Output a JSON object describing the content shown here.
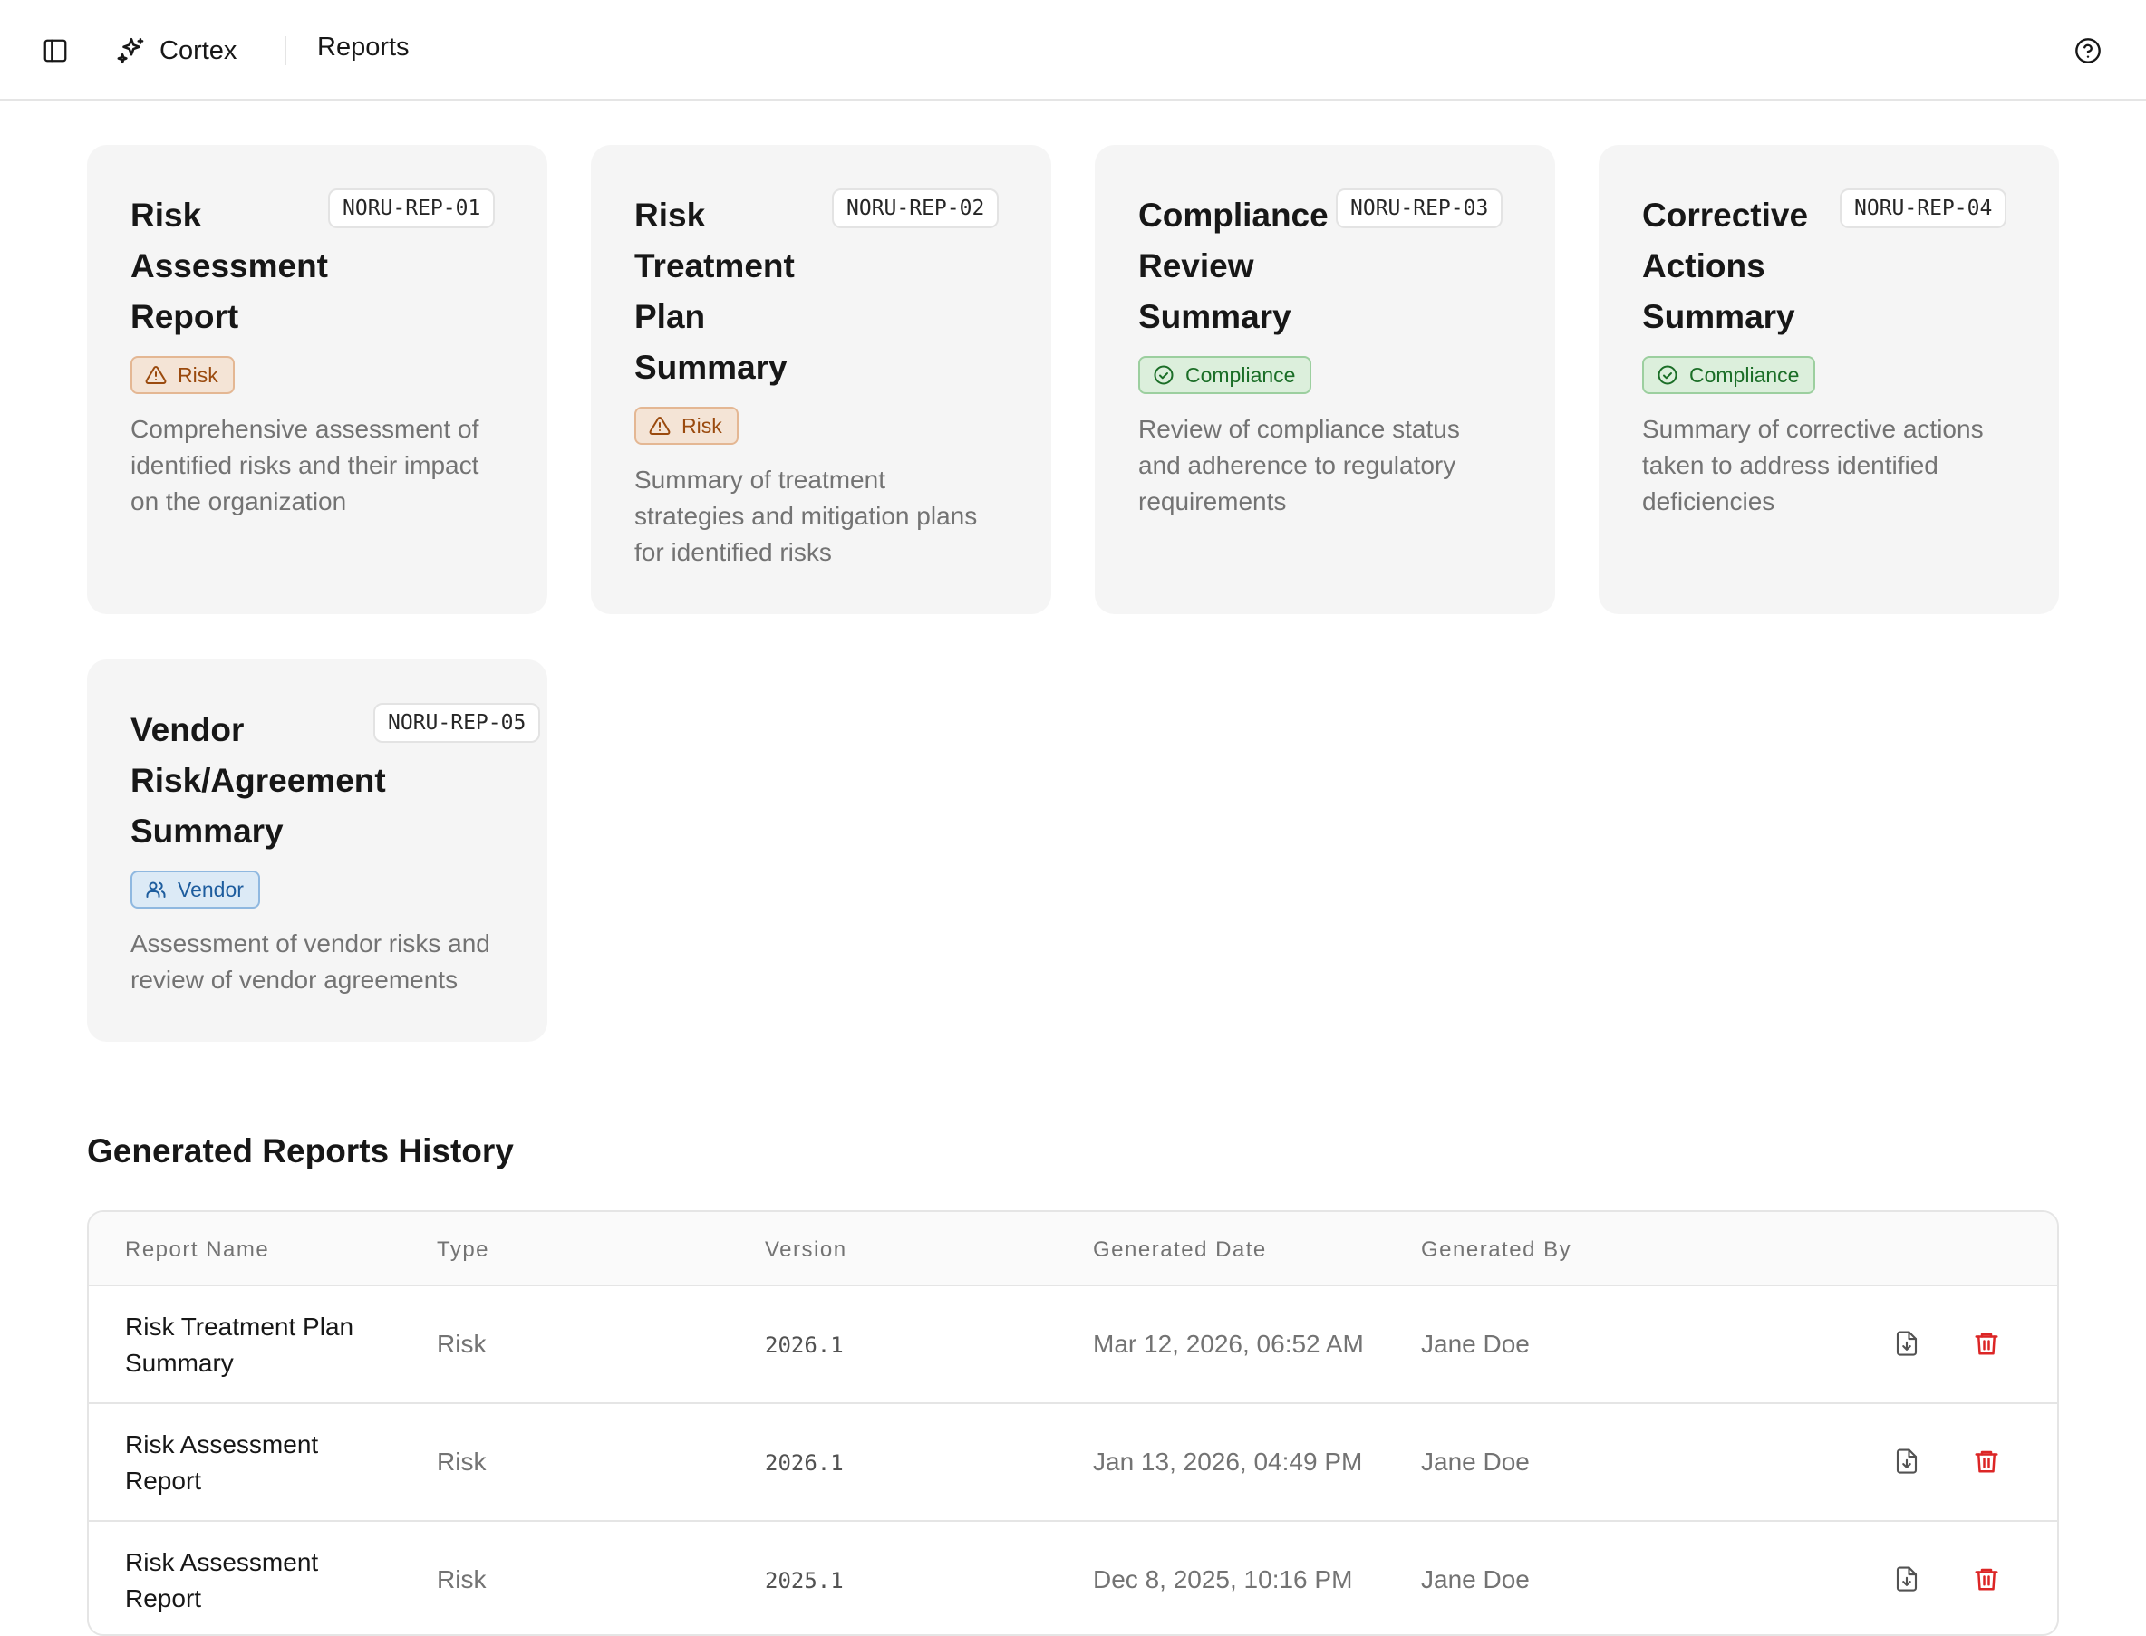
{
  "header": {
    "app_name": "Cortex",
    "breadcrumb": "Reports",
    "icons": {
      "sidebar": "sidebar-toggle-icon",
      "brand": "sparkles-icon",
      "help": "help-circle-icon"
    }
  },
  "cards": [
    {
      "title_lines": [
        "Risk",
        "Assessment",
        "Report"
      ],
      "code": "NORU-REP-01",
      "tag": "Risk",
      "tag_icon": "alert-triangle-icon",
      "desc_lines": [
        "Comprehensive assessment of",
        "identified risks and their impact",
        "on the organization"
      ]
    },
    {
      "title_lines": [
        "Risk",
        "Treatment",
        "Plan",
        "Summary"
      ],
      "code": "NORU-REP-02",
      "tag": "Risk",
      "tag_icon": "alert-triangle-icon",
      "desc_lines": [
        "Summary of treatment",
        "strategies and mitigation plans",
        "for identified risks"
      ]
    },
    {
      "title_lines": [
        "Compliance",
        "Review",
        "Summary"
      ],
      "code": "NORU-REP-03",
      "tag": "Compliance",
      "tag_icon": "check-circle-icon",
      "desc_lines": [
        "Review of compliance status",
        "and adherence to regulatory",
        "requirements"
      ]
    },
    {
      "title_lines": [
        "Corrective",
        "Actions",
        "Summary"
      ],
      "code": "NORU-REP-04",
      "tag": "Compliance",
      "tag_icon": "check-circle-icon",
      "desc_lines": [
        "Summary of corrective actions",
        "taken to address identified",
        "deficiencies"
      ]
    },
    {
      "title_lines": [
        "Vendor",
        "Risk/Agreement",
        "Summary"
      ],
      "code": "NORU-REP-05",
      "tag": "Vendor",
      "tag_icon": "users-icon",
      "desc_lines": [
        "Assessment of vendor risks and",
        "review of vendor agreements"
      ]
    }
  ],
  "history": {
    "title": "Generated Reports History",
    "columns": [
      "Report Name",
      "Type",
      "Version",
      "Generated Date",
      "Generated By"
    ],
    "rows": [
      {
        "name_lines": [
          "Risk Treatment Plan",
          "Summary"
        ],
        "type": "Risk",
        "version": "2026.1",
        "date": "Mar 12, 2026, 06:52 AM",
        "by": "Jane Doe"
      },
      {
        "name_lines": [
          "Risk Assessment",
          "Report"
        ],
        "type": "Risk",
        "version": "2026.1",
        "date": "Jan 13, 2026, 04:49 PM",
        "by": "Jane Doe"
      },
      {
        "name_lines": [
          "Risk Assessment",
          "Report"
        ],
        "type": "Risk",
        "version": "2025.1",
        "date": "Dec 8, 2025, 10:16 PM",
        "by": "Jane Doe"
      }
    ],
    "row_actions": {
      "download_icon": "file-download-icon",
      "delete_icon": "trash-icon"
    }
  },
  "colors": {
    "card_bg": "#f5f5f5",
    "risk_tag": "#9a4a0e",
    "compliance_tag": "#1b6e27",
    "vendor_tag": "#1e5d9e",
    "delete_red": "#dc2626"
  }
}
